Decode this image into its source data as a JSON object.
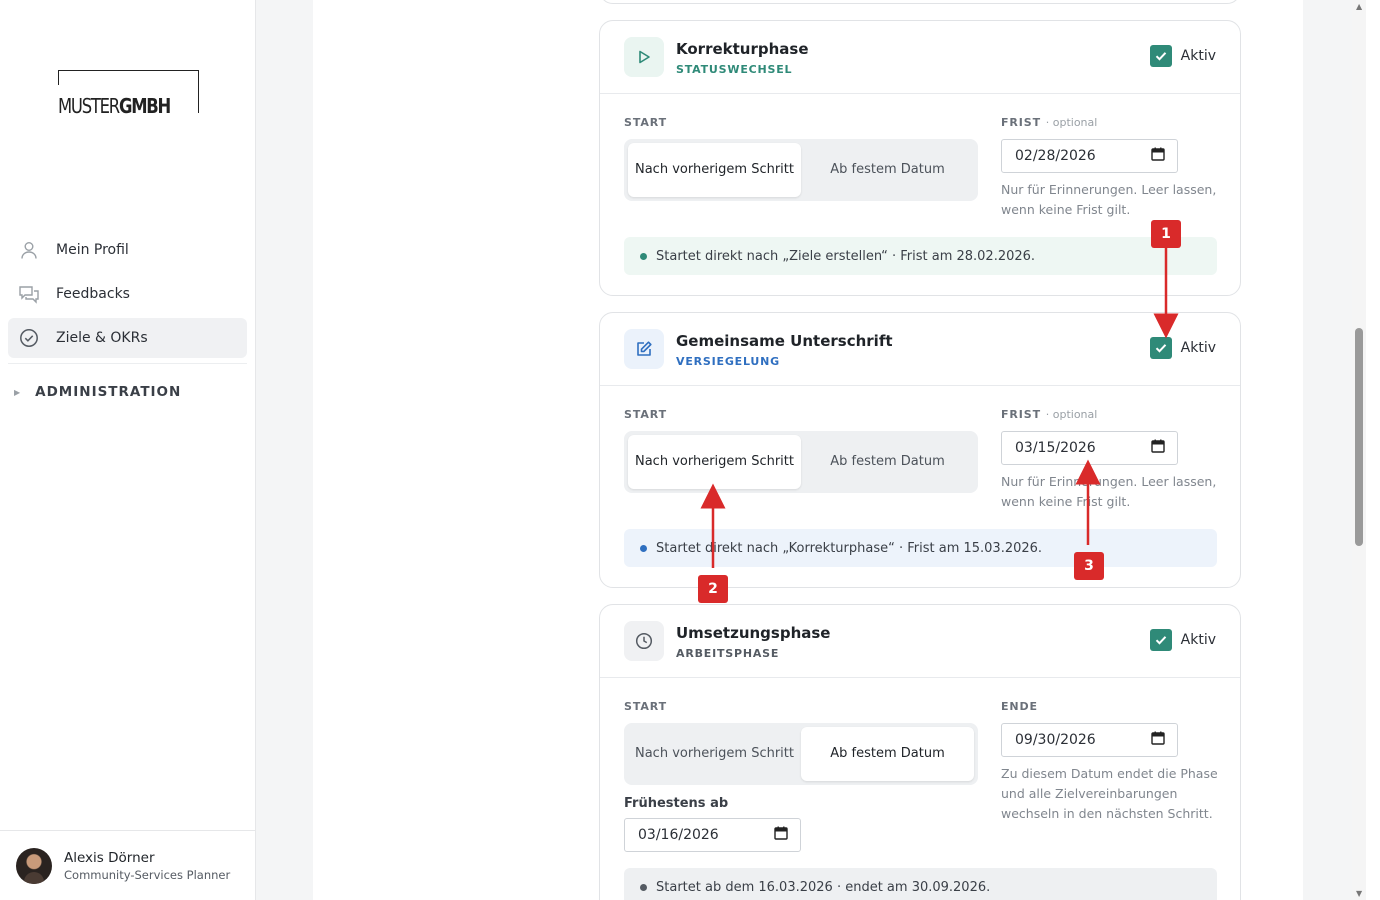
{
  "logo": {
    "part1": "MUSTER",
    "part2": "GMBH"
  },
  "nav": {
    "items": [
      {
        "label": "Mein Profil",
        "icon": "person-icon"
      },
      {
        "label": "Feedbacks",
        "icon": "chat-bubbles-icon"
      },
      {
        "label": "Ziele & OKRs",
        "icon": "check-circle-icon",
        "active": true
      }
    ],
    "admin": "ADMINISTRATION"
  },
  "user": {
    "name": "Alexis Dörner",
    "role": "Community-Services Planner"
  },
  "labels": {
    "start": "START",
    "frist": "FRIST",
    "optional": "· optional",
    "ende": "ENDE",
    "aktiv": "Aktiv",
    "fruehestens": "Frühestens ab"
  },
  "segment": {
    "after_previous": "Nach vorherigem Schritt",
    "fixed_date": "Ab festem Datum"
  },
  "phases": [
    {
      "title": "Korrekturphase",
      "subtitle": "STATUSWECHSEL",
      "accent": "#2f8a78",
      "icon": "play-icon",
      "aktiv": true,
      "start_mode": "Nach vorherigem Schritt",
      "deadline": "02/28/2026",
      "help": "Nur für Erinnerungen. Leer lassen, wenn keine Frist gilt.",
      "info": "Startet direkt nach „Ziele erstellen“ · Frist am 28.02.2026."
    },
    {
      "title": "Gemeinsame Unterschrift",
      "subtitle": "VERSIEGELUNG",
      "accent": "#2f6fc0",
      "icon": "pen-edit-icon",
      "aktiv": true,
      "start_mode": "Nach vorherigem Schritt",
      "deadline": "03/15/2026",
      "help": "Nur für Erinnerungen. Leer lassen, wenn keine Frist gilt.",
      "info": "Startet direkt nach „Korrekturphase“ · Frist am 15.03.2026."
    },
    {
      "title": "Umsetzungsphase",
      "subtitle": "ARBEITSPHASE",
      "accent": "#555b63",
      "icon": "clock-icon",
      "aktiv": true,
      "start_mode": "Ab festem Datum",
      "end_date": "09/30/2026",
      "earliest": "03/16/2026",
      "help": "Zu diesem Datum endet die Phase und alle Zielvereinbarungen wechseln in den nächsten Schritt.",
      "info": "Startet ab dem 16.03.2026 · endet am 30.09.2026."
    }
  ],
  "annotations": [
    "1",
    "2",
    "3"
  ],
  "colors": {
    "annotation": "#d92a2a",
    "checkbox": "#2f8a78"
  }
}
